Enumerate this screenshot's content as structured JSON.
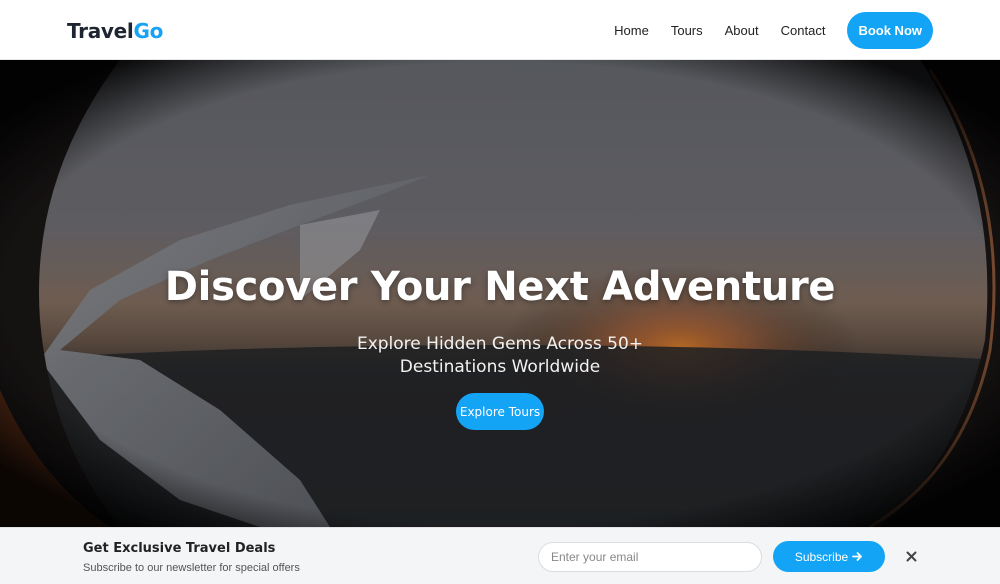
{
  "header": {
    "logo_main": "Travel",
    "logo_accent": "Go",
    "nav": [
      "Home",
      "Tours",
      "About",
      "Contact"
    ],
    "cta_label": "Book Now"
  },
  "hero": {
    "title": "Discover Your Next Adventure",
    "subtitle": "Explore Hidden Gems Across 50+ Destinations Worldwide",
    "button_label": "Explore Tours"
  },
  "newsletter": {
    "title": "Get Exclusive Travel Deals",
    "subtitle": "Subscribe to our newsletter for special offers",
    "email_placeholder": "Enter your email",
    "email_value": "",
    "subscribe_label": "Subscribe",
    "subscribe_icon": "arrow-right-icon",
    "close_icon": "close-icon"
  },
  "colors": {
    "accent": "#14a4f6",
    "text_dark": "#222222",
    "newsletter_bg": "#f4f5f7"
  }
}
